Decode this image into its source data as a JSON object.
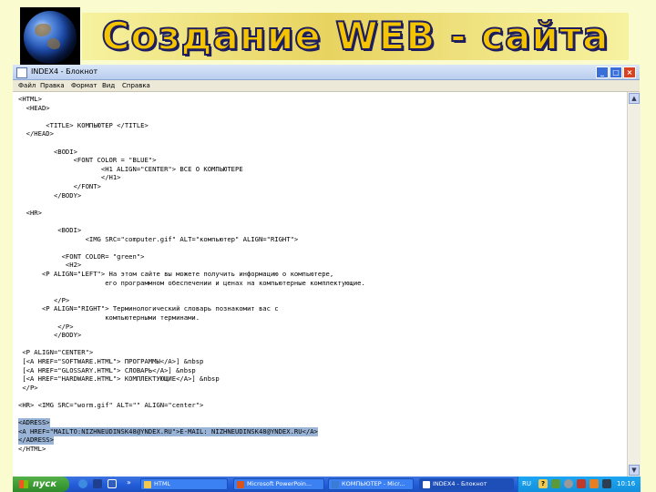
{
  "slide": {
    "title": "Создание WEB - сайта"
  },
  "window": {
    "title": "INDEX4 - Блокнот",
    "menu": [
      "Файл",
      "Правка",
      "Формат",
      "Вид",
      "Справка"
    ]
  },
  "editor": {
    "lines": [
      "<HTML>",
      "  <HEAD>",
      "",
      "       <TITLE> КОМПЬЮТЕР </TITLE>",
      "  </HEAD>",
      "",
      "         <BODI>",
      "              <FONT COLOR = \"BLUE\">",
      "                     <H1 ALIGN=\"CENTER\"> ВСЕ О КОМПЬЮТЕРЕ",
      "                     </H1>",
      "              </FONT>",
      "         </BODY>",
      "",
      "  <HR>",
      "",
      "          <BODI>",
      "                 <IMG SRC=\"computer.gif\" ALT=\"компьютер\" ALIGN=\"RIGHT\">",
      "",
      "           <FONT COLOR= \"green\">",
      "            <H2>",
      "      <P ALIGN=\"LEFT\"> На этом сайте вы можете получить информацию о компьютере,",
      "                      его программном обеспечении и ценах на компьютерные комплектующие.",
      "",
      "         </P>",
      "      <P ALIGN=\"RIGHT\"> Терминологический словарь познакомит вас с",
      "                      компьютерными терминами.",
      "          </P>",
      "         </BODY>",
      "",
      " <P ALIGN=\"CENTER\">",
      " [<A HREF=\"SOFTWARE.HTML\"> ПРОГРАММЫ</A>] &nbsp",
      " [<A HREF=\"GLOSSARY.HTML\"> СЛОВАРЬ</A>] &nbsp",
      " [<A HREF=\"HARDWARE.HTML\"> КОМПЛЕКТУЮЩИЕ</A>] &nbsp",
      " </P>",
      "",
      "<HR> <IMG SRC=\"worm.gif\" ALT=\"\" ALIGN=\"center\">",
      "",
      "<ADRESS>",
      "<A HREF=\"MAILTO:NIZHNEUDINSK48@YNDEX.RU\">E-MAIL: NIZHNEUDINSK48@YNDEX.RU</A>",
      "</ADRESS>",
      "</HTML>"
    ],
    "selected_from": 37,
    "selected_to": 39
  },
  "taskbar": {
    "start_label": "пуск",
    "quick_launch_more": "»",
    "tasks": [
      {
        "label": "HTML",
        "active": false,
        "icon_color": "#f2c94c"
      },
      {
        "label": "Microsoft PowerPoin...",
        "active": false,
        "icon_color": "#d9541e"
      },
      {
        "label": "КОМПЬЮТЕР - Micr...",
        "active": false,
        "icon_color": "#3a7bd5"
      },
      {
        "label": "INDEX4 - Блокнот",
        "active": true,
        "icon_color": "#ffffff"
      }
    ],
    "tray": {
      "language": "RU",
      "clock": "10:16"
    }
  },
  "colors": {
    "slide_background": "#fbfbd0",
    "title_fill": "#f5c400",
    "title_outline": "#1d1d60",
    "selection": "#99b4d6",
    "taskbar": "#245edb",
    "start_button": "#3a9a34"
  }
}
